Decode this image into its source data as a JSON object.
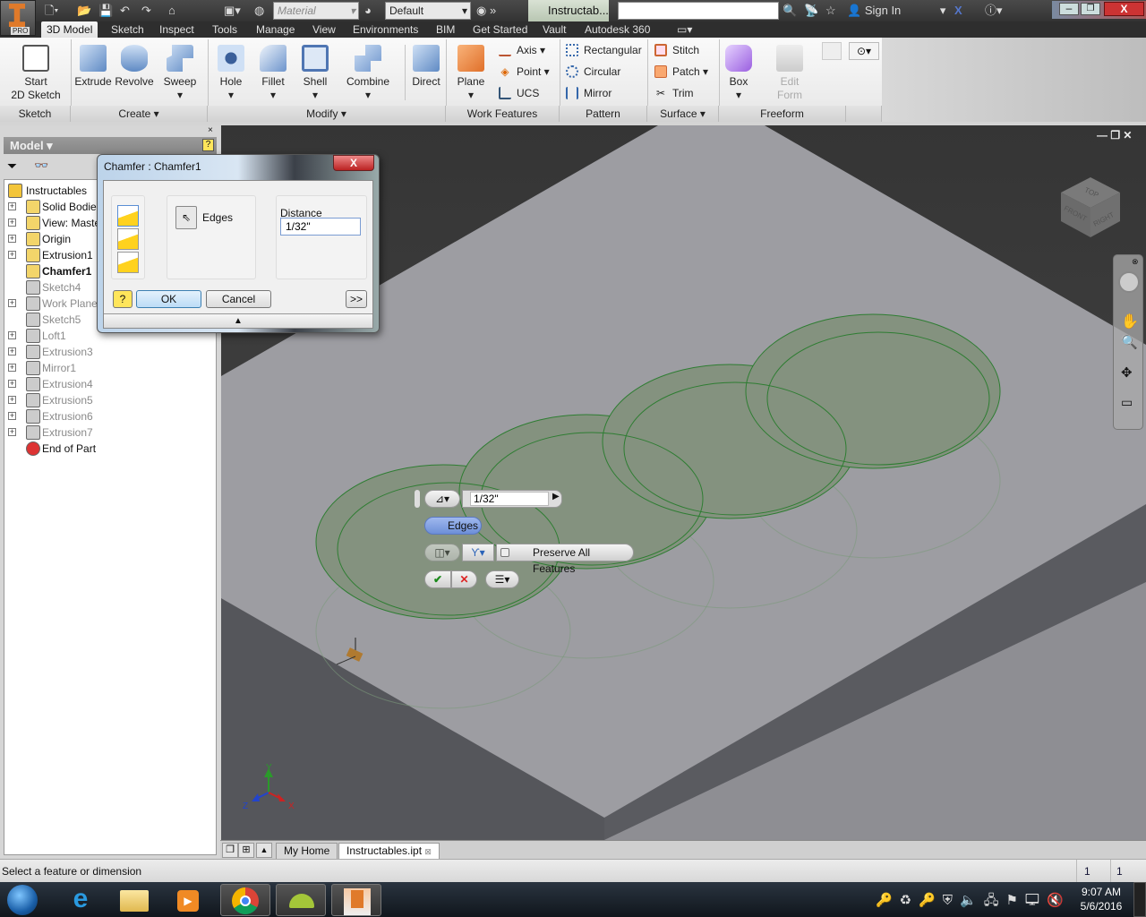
{
  "app": {
    "logo_text": "PRO",
    "doc_title": "Instructab...",
    "search_placeholder": "",
    "sign_in": "Sign In"
  },
  "quick_access": {
    "material": "Material",
    "appearance": "Default"
  },
  "ribbon_tabs": [
    "3D Model",
    "Sketch",
    "Inspect",
    "Tools",
    "Manage",
    "View",
    "Environments",
    "BIM",
    "Get Started",
    "Vault",
    "Autodesk 360"
  ],
  "ribbon": {
    "sketch": {
      "start_line1": "Start",
      "start_line2": "2D Sketch",
      "title": "Sketch"
    },
    "create": {
      "extrude": "Extrude",
      "revolve": "Revolve",
      "sweep": "Sweep",
      "title": "Create ▾"
    },
    "modify": {
      "hole": "Hole",
      "fillet": "Fillet",
      "shell": "Shell",
      "combine": "Combine",
      "direct": "Direct",
      "title": "Modify ▾"
    },
    "work_features": {
      "plane": "Plane",
      "axis": "Axis ▾",
      "point": "Point ▾",
      "ucs": "UCS",
      "title": "Work Features"
    },
    "pattern": {
      "rectangular": "Rectangular",
      "circular": "Circular",
      "mirror": "Mirror",
      "title": "Pattern"
    },
    "surface": {
      "stitch": "Stitch",
      "patch": "Patch ▾",
      "trim": "Trim",
      "title": "Surface ▾"
    },
    "freeform": {
      "box": "Box",
      "edit_line1": "Edit",
      "edit_line2": "Form",
      "title": "Freeform"
    }
  },
  "browser": {
    "title": "Model ▾",
    "tree": [
      {
        "label": "Instructables",
        "bold": false,
        "dim": false,
        "expand": false,
        "root": true
      },
      {
        "label": "Solid Bodies(",
        "dim": false,
        "expand": true
      },
      {
        "label": "View: Master",
        "dim": false,
        "expand": true
      },
      {
        "label": "Origin",
        "dim": false,
        "expand": true
      },
      {
        "label": "Extrusion1",
        "dim": false,
        "expand": true
      },
      {
        "label": "Chamfer1",
        "bold": true,
        "dim": false,
        "expand": false
      },
      {
        "label": "Sketch4",
        "dim": true,
        "expand": false
      },
      {
        "label": "Work Plane2",
        "dim": true,
        "expand": true
      },
      {
        "label": "Sketch5",
        "dim": true,
        "expand": false
      },
      {
        "label": "Loft1",
        "dim": true,
        "expand": true
      },
      {
        "label": "Extrusion3",
        "dim": true,
        "expand": true
      },
      {
        "label": "Mirror1",
        "dim": true,
        "expand": true
      },
      {
        "label": "Extrusion4",
        "dim": true,
        "expand": true
      },
      {
        "label": "Extrusion5",
        "dim": true,
        "expand": true
      },
      {
        "label": "Extrusion6",
        "dim": true,
        "expand": true
      },
      {
        "label": "Extrusion7",
        "dim": true,
        "expand": true
      },
      {
        "label": "End of Part",
        "dim": false,
        "expand": false
      }
    ]
  },
  "dialog": {
    "title": "Chamfer : Chamfer1",
    "edges_label": "Edges",
    "distance_label": "Distance",
    "distance_value": "1/32\"",
    "ok": "OK",
    "cancel": "Cancel",
    "more": ">>"
  },
  "minitoolbar": {
    "distance_value": "1/32\"",
    "edges": "Edges",
    "preserve": "Preserve All Features"
  },
  "viewcube": {
    "top": "TOP",
    "front": "FRONT",
    "right": "RIGHT"
  },
  "triad": {
    "x": "X",
    "y": "Y",
    "z": "Z"
  },
  "doc_tabs": {
    "home": "My Home",
    "active": "Instructables.ipt"
  },
  "status": {
    "message": "Select a feature or dimension",
    "count1": "1",
    "count2": "1"
  },
  "taskbar": {
    "time": "9:07 AM",
    "date": "5/6/2016"
  },
  "colors": {
    "accent": "#e07a2a",
    "edge_highlight": "#2e7d32",
    "plate_top": "#9d9da2"
  }
}
